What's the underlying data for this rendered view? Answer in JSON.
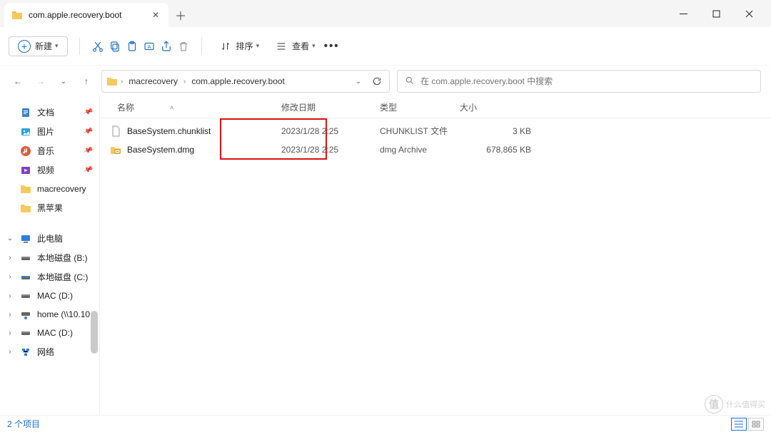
{
  "tab": {
    "title": "com.apple.recovery.boot"
  },
  "toolbar": {
    "new_label": "新建",
    "sort_label": "排序",
    "view_label": "查看"
  },
  "breadcrumb": {
    "segments": [
      "macrecovery",
      "com.apple.recovery.boot"
    ]
  },
  "search": {
    "placeholder": "在 com.apple.recovery.boot 中搜索"
  },
  "sidebar": {
    "quick": [
      {
        "label": "文档",
        "icon": "doc",
        "pinned": true
      },
      {
        "label": "图片",
        "icon": "pic",
        "pinned": true
      },
      {
        "label": "音乐",
        "icon": "music",
        "pinned": true
      },
      {
        "label": "视频",
        "icon": "video",
        "pinned": true
      },
      {
        "label": "macrecovery",
        "icon": "folder",
        "pinned": false
      },
      {
        "label": "黑苹果",
        "icon": "folder",
        "pinned": false
      }
    ],
    "pc_label": "此电脑",
    "drives": [
      {
        "label": "本地磁盘 (B:)",
        "icon": "drive"
      },
      {
        "label": "本地磁盘 (C:)",
        "icon": "drive-sys"
      },
      {
        "label": "MAC (D:)",
        "icon": "drive"
      },
      {
        "label": "home (\\\\10.10",
        "icon": "netdrive"
      },
      {
        "label": "MAC (D:)",
        "icon": "drive"
      },
      {
        "label": "网络",
        "icon": "network"
      }
    ]
  },
  "columns": {
    "name": "名称",
    "date": "修改日期",
    "type": "类型",
    "size": "大小"
  },
  "files": [
    {
      "name": "BaseSystem.chunklist",
      "date": "2023/1/28 2:25",
      "type": "CHUNKLIST 文件",
      "size": "3 KB",
      "icon": "file"
    },
    {
      "name": "BaseSystem.dmg",
      "date": "2023/1/28 2:25",
      "type": "dmg Archive",
      "size": "678,865 KB",
      "icon": "dmg"
    }
  ],
  "status": {
    "count": "2 个项目"
  },
  "watermark": {
    "text": "什么值得买"
  }
}
